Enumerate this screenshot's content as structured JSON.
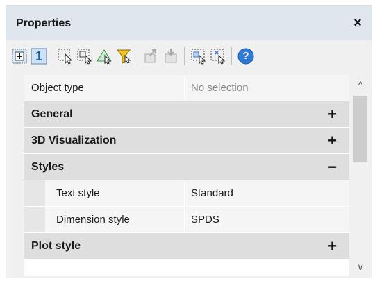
{
  "panel": {
    "title": "Properties",
    "close_glyph": "×"
  },
  "toolbar": {
    "buttons": [
      {
        "name": "toggle-pickadd-icon"
      },
      {
        "name": "pickadd-value-icon",
        "label": "1"
      },
      {
        "name": "select-objects-icon"
      },
      {
        "name": "select-window-icon"
      },
      {
        "name": "select-crossing-icon"
      },
      {
        "name": "quick-select-icon"
      },
      {
        "name": "export-properties-icon"
      },
      {
        "name": "import-properties-icon"
      },
      {
        "name": "select-similar-icon"
      },
      {
        "name": "deselect-icon"
      },
      {
        "name": "help-icon",
        "label": "?"
      }
    ],
    "accent": "#2f7ad6",
    "filter_accent": "#e0a800",
    "green_accent": "#2e9e3e"
  },
  "object_type": {
    "label": "Object type",
    "value": "No selection"
  },
  "categories": [
    {
      "label": "General",
      "toggle": "+"
    },
    {
      "label": "3D Visualization",
      "toggle": "+"
    },
    {
      "label": "Styles",
      "toggle": "−"
    },
    {
      "label": "Plot style",
      "toggle": "+"
    }
  ],
  "styles_props": [
    {
      "label": "Text style",
      "value": "Standard"
    },
    {
      "label": "Dimension style",
      "value": "SPDS"
    }
  ],
  "scrollbar": {
    "up": "^",
    "down": "v"
  }
}
